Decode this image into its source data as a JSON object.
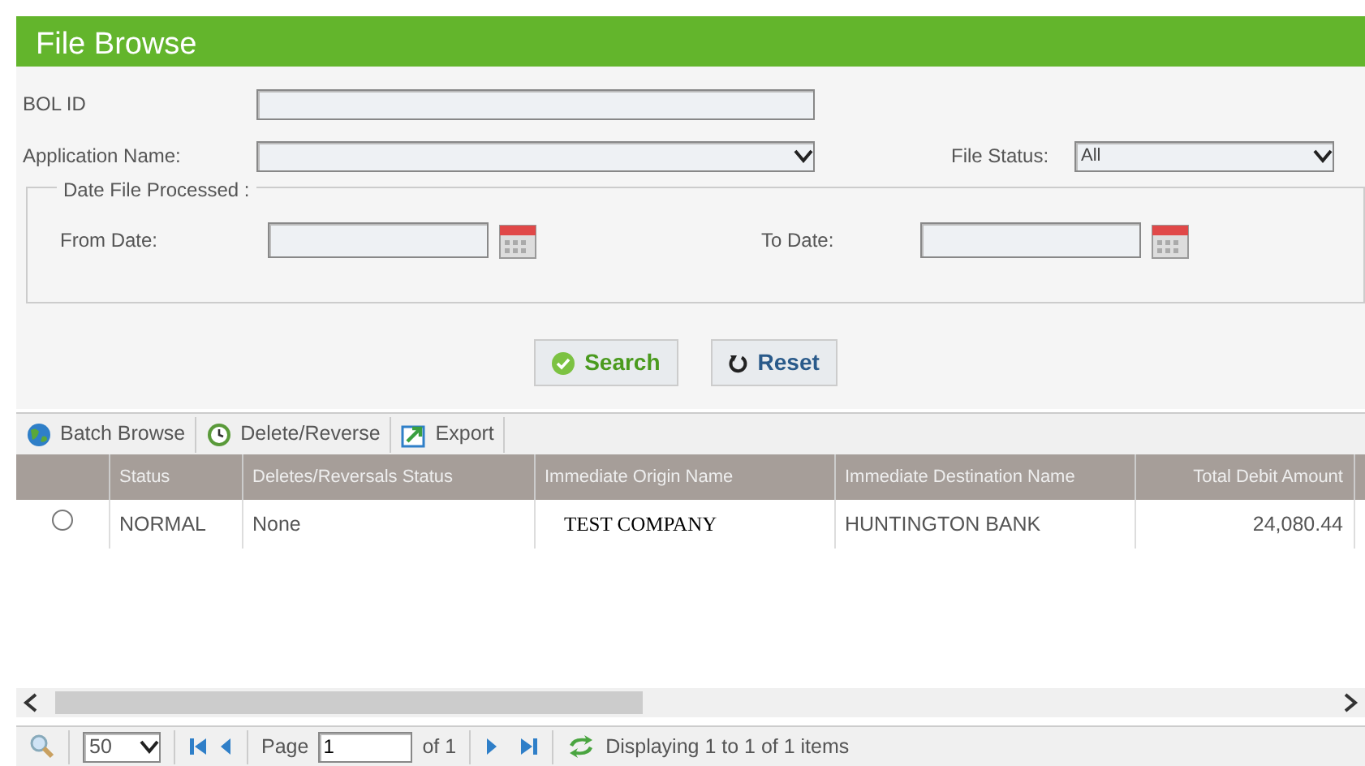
{
  "header": {
    "title": "File Browse"
  },
  "form": {
    "bol_id": {
      "label": "BOL ID"
    },
    "application": {
      "label": "Application Name:"
    },
    "file_status": {
      "label": "File Status:",
      "value": "All"
    },
    "date_group": {
      "legend": "Date File Processed :",
      "from_label": "From Date:",
      "to_label": "To Date:"
    }
  },
  "buttons": [
    {
      "label": "Search",
      "kind": "search"
    },
    {
      "label": "Reset",
      "kind": "reset"
    }
  ],
  "toolbar": [
    {
      "label": "Batch Browse",
      "kind": "globe"
    },
    {
      "label": "Delete/Reverse",
      "kind": "clock"
    },
    {
      "label": "Export",
      "kind": "export"
    }
  ],
  "table": {
    "columns": [
      "Status",
      "Deletes/Reversals Status",
      "Immediate Origin Name",
      "Immediate Destination Name",
      "Total Debit Amount"
    ],
    "rows": [
      {
        "selected": false,
        "cells": [
          "NORMAL",
          "None",
          "TEST COMPANY",
          "HUNTINGTON BANK",
          "24,080.44"
        ]
      }
    ]
  },
  "pager": {
    "page_size": "50",
    "page_label": "Page",
    "page": "1",
    "of": "of 1",
    "summary": "Displaying 1 to 1 of 1 items"
  }
}
